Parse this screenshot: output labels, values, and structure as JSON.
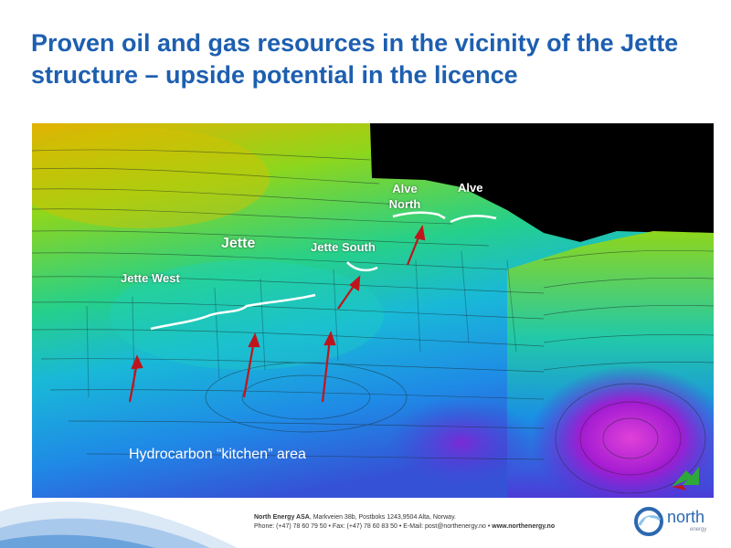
{
  "slide": {
    "title": "Proven oil and gas resources in the vicinity of the Jette structure – upside potential in the licence"
  },
  "map": {
    "labels": {
      "jette": "Jette",
      "jette_west": "Jette West",
      "jette_south": "Jette South",
      "alve_north": "Alve North",
      "alve": "Alve"
    },
    "kitchen_label": "Hydrocarbon “kitchen” area",
    "colors": {
      "high": "#e8b500",
      "mid_high": "#7fd321",
      "mid": "#22c8b4",
      "mid_low": "#1aa8e6",
      "low": "#3a4fd8",
      "deep": "#b01ed4",
      "migration_arrow": "#c0141c",
      "outline": "#ffffff"
    }
  },
  "footer": {
    "company": "North Energy ASA",
    "address": ", Markveien 38b, Postboks 1243,9504 Alta, Norway.",
    "contact": "Phone: (+47) 78 60 79 50 • Fax: (+47) 78 60 83 50 • E-Mail: post@northenergy.no • ",
    "website": "www.northenergy.no"
  },
  "logo": {
    "word": "north",
    "sub": "energy",
    "icon": "north-energy-logo-icon"
  }
}
